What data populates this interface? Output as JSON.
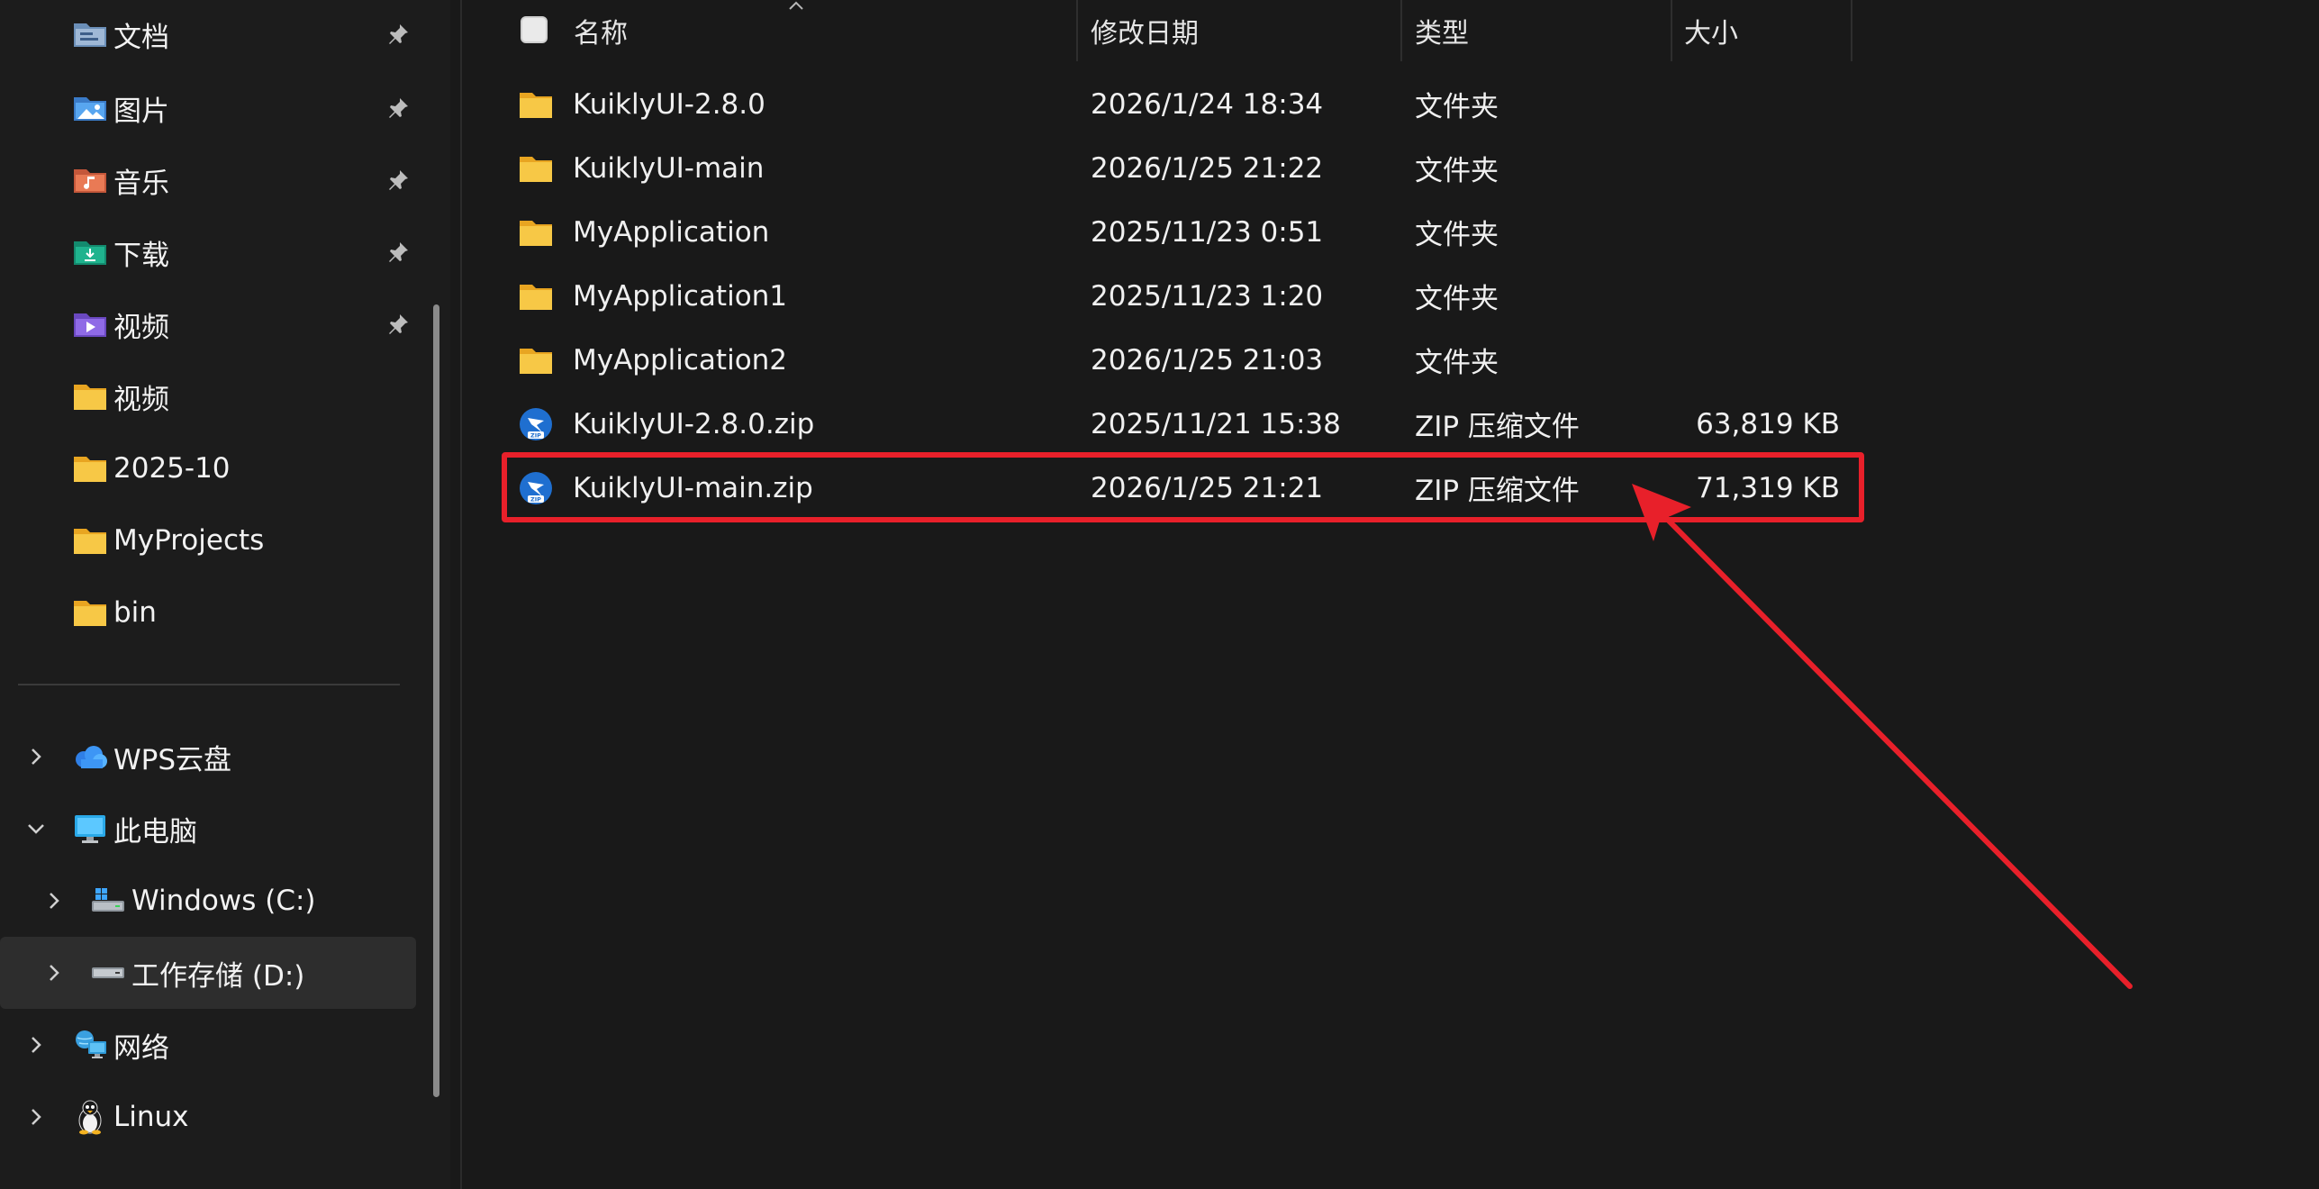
{
  "sidebar": {
    "quick_access": [
      {
        "label": "文档",
        "icon": "documents-icon",
        "pinned": true
      },
      {
        "label": "图片",
        "icon": "pictures-icon",
        "pinned": true
      },
      {
        "label": "音乐",
        "icon": "music-icon",
        "pinned": true
      },
      {
        "label": "下载",
        "icon": "downloads-icon",
        "pinned": true
      },
      {
        "label": "视频",
        "icon": "videos-icon",
        "pinned": true
      },
      {
        "label": "视频",
        "icon": "folder-icon",
        "pinned": false
      },
      {
        "label": "2025-10",
        "icon": "folder-icon",
        "pinned": false
      },
      {
        "label": "MyProjects",
        "icon": "folder-icon",
        "pinned": false
      },
      {
        "label": "bin",
        "icon": "folder-icon",
        "pinned": false
      }
    ],
    "tree": [
      {
        "label": "WPS云盘",
        "icon": "cloud-icon",
        "state": "collapsed"
      },
      {
        "label": "此电脑",
        "icon": "computer-icon",
        "state": "expanded"
      },
      {
        "label": "Windows (C:)",
        "icon": "windows-drive-icon",
        "state": "collapsed"
      },
      {
        "label": "工作存储 (D:)",
        "icon": "drive-icon",
        "state": "collapsed",
        "selected": true
      },
      {
        "label": "网络",
        "icon": "network-icon",
        "state": "collapsed"
      },
      {
        "label": "Linux",
        "icon": "linux-penguin-icon",
        "state": "collapsed"
      }
    ]
  },
  "columns": {
    "name": "名称",
    "date": "修改日期",
    "type": "类型",
    "size": "大小"
  },
  "files": [
    {
      "name": "KuiklyUI-2.8.0",
      "date": "2026/1/24 18:34",
      "type": "文件夹",
      "size": "",
      "icon": "folder-icon"
    },
    {
      "name": "KuiklyUI-main",
      "date": "2026/1/25 21:22",
      "type": "文件夹",
      "size": "",
      "icon": "folder-icon"
    },
    {
      "name": "MyApplication",
      "date": "2025/11/23 0:51",
      "type": "文件夹",
      "size": "",
      "icon": "folder-icon"
    },
    {
      "name": "MyApplication1",
      "date": "2025/11/23 1:20",
      "type": "文件夹",
      "size": "",
      "icon": "folder-icon"
    },
    {
      "name": "MyApplication2",
      "date": "2026/1/25 21:03",
      "type": "文件夹",
      "size": "",
      "icon": "folder-icon"
    },
    {
      "name": "KuiklyUI-2.8.0.zip",
      "date": "2025/11/21 15:38",
      "type": "ZIP 压缩文件",
      "size": "63,819 KB",
      "icon": "zip-archive-icon"
    },
    {
      "name": "KuiklyUI-main.zip",
      "date": "2026/1/25 21:21",
      "type": "ZIP 压缩文件",
      "size": "71,319 KB",
      "icon": "zip-archive-icon",
      "highlighted": true
    }
  ],
  "colors": {
    "annotation": "#e8202a",
    "folder": "#f7c846",
    "zip_icon": "#1f6fd0"
  }
}
